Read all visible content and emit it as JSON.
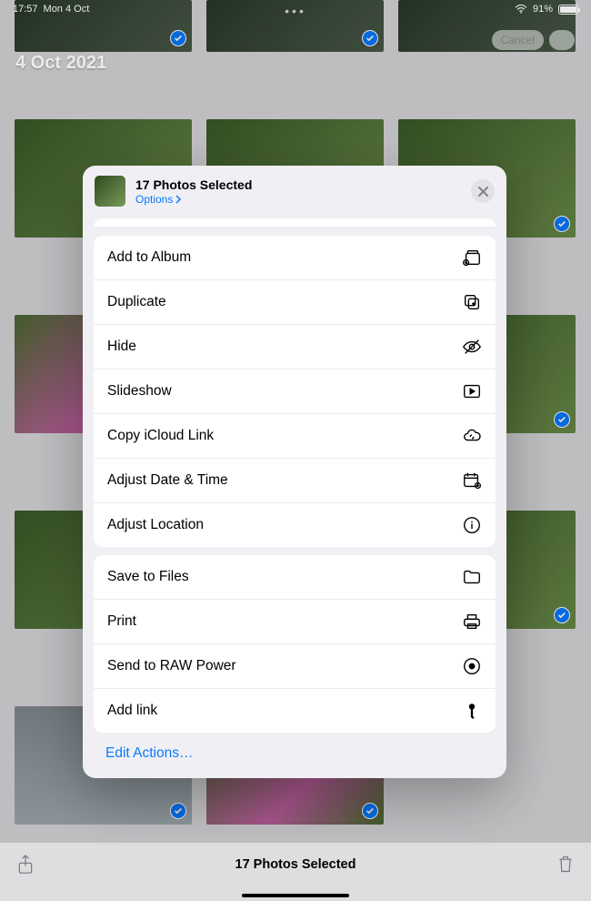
{
  "status": {
    "time": "17:57",
    "date": "Mon 4 Oct",
    "battery_pct": "91%"
  },
  "section_date": "4 Oct 2021",
  "top_buttons": {
    "cancel": "Cancel"
  },
  "sheet": {
    "title": "17 Photos Selected",
    "options_label": "Options",
    "group1": [
      {
        "label": "Add to Album",
        "icon": "album-add-icon"
      },
      {
        "label": "Duplicate",
        "icon": "duplicate-icon"
      },
      {
        "label": "Hide",
        "icon": "eye-slash-icon"
      },
      {
        "label": "Slideshow",
        "icon": "play-rect-icon"
      },
      {
        "label": "Copy iCloud Link",
        "icon": "cloud-link-icon"
      },
      {
        "label": "Adjust Date & Time",
        "icon": "calendar-adjust-icon"
      },
      {
        "label": "Adjust Location",
        "icon": "info-circle-icon"
      }
    ],
    "group2": [
      {
        "label": "Save to Files",
        "icon": "folder-icon"
      },
      {
        "label": "Print",
        "icon": "printer-icon"
      },
      {
        "label": "Send to RAW Power",
        "icon": "aperture-icon"
      },
      {
        "label": "Add link",
        "icon": "key-icon"
      }
    ],
    "edit_actions": "Edit Actions…"
  },
  "bottom": {
    "selected_label": "17 Photos Selected"
  }
}
